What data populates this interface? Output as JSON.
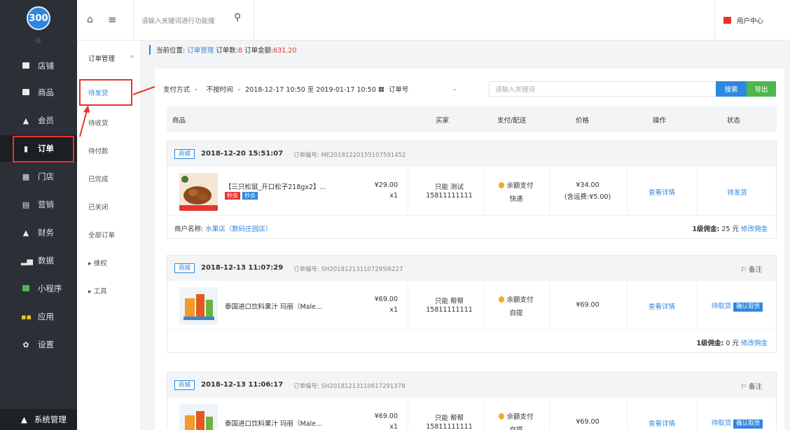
{
  "app": {
    "logo_text": "300"
  },
  "sidebar": {
    "items": [
      {
        "label": "店铺",
        "icon": "store-icon"
      },
      {
        "label": "商品",
        "icon": "product-icon"
      },
      {
        "label": "会员",
        "icon": "member-icon"
      },
      {
        "label": "订单",
        "icon": "order-icon",
        "active": true
      },
      {
        "label": "门店",
        "icon": "shop-icon"
      },
      {
        "label": "营销",
        "icon": "marketing-icon"
      },
      {
        "label": "财务",
        "icon": "finance-icon"
      },
      {
        "label": "数据",
        "icon": "data-icon"
      },
      {
        "label": "小程序",
        "icon": "miniprogram-icon"
      },
      {
        "label": "应用",
        "icon": "apps-icon"
      },
      {
        "label": "设置",
        "icon": "settings-icon"
      }
    ],
    "bottom_label": "系统管理"
  },
  "topbar": {
    "search_placeholder": "请输入关键词进行功能搜",
    "user_center": "用户中心"
  },
  "subnav": {
    "title": "订单管理",
    "items": [
      "待发货",
      "待收货",
      "待付款",
      "已完成",
      "已关闭",
      "全部订单",
      "维权",
      "工具"
    ]
  },
  "breadcrumb": {
    "prefix": "当前位置:",
    "current": "订单管理",
    "count_label": "订单数:",
    "count": "8",
    "amount_label": "订单金额:",
    "amount": "631.20"
  },
  "filters": {
    "payment": "支付方式",
    "time_mode": "不按时间",
    "date_range": "2018-12-17 10:50 至 2019-01-17 10:50",
    "field": "订单号",
    "keyword_placeholder": "请输入关键词",
    "search_label": "搜索",
    "export_label": "导出"
  },
  "table": {
    "headers": [
      "商品",
      "买家",
      "支付/配送",
      "价格",
      "操作",
      "状态"
    ]
  },
  "orders": [
    {
      "tag": "商城",
      "time": "2018-12-20 15:51:07",
      "order_no": "订单编号: ME20181220155107591452",
      "product": "【三只松鼠_开口松子218gx2】...",
      "badges": [
        "秒杀",
        "秒杀"
      ],
      "unit_price": "¥29.00",
      "qty": "x1",
      "buyer_name": "只能 测试",
      "buyer_phone": "15811111111",
      "pay_method": "余额支付",
      "delivery": "快递",
      "total": "¥34.00",
      "shipping": "(含运费:¥5.00)",
      "action": "查看详情",
      "status": "待发货",
      "merchant_label": "商户名称:",
      "merchant": "水果店（数码庄园店）",
      "commission_label": "1级佣金:",
      "commission": "25 元",
      "commission_edit": "修改佣金"
    },
    {
      "tag": "商城",
      "time": "2018-12-13 11:07:29",
      "order_no": "订单编号: SH201812131107295l6227",
      "remark": "备注",
      "product": "泰国进口饮料果汁 玛丽（Male...",
      "unit_price": "¥69.00",
      "qty": "x1",
      "buyer_name": "只能 帮帮",
      "buyer_phone": "15811111111",
      "pay_method": "余额支付",
      "delivery": "自提",
      "total": "¥69.00",
      "action": "查看详情",
      "status": "待取货",
      "confirm": "确认取货",
      "commission_label": "1级佣金:",
      "commission": "0 元",
      "commission_edit": "修改佣金"
    },
    {
      "tag": "商城",
      "time": "2018-12-13 11:06:17",
      "order_no": "订单编号: SH20181213110617291378",
      "remark": "备注",
      "product": "泰国进口饮料果汁 玛丽（Male...",
      "unit_price": "¥69.00",
      "qty": "x1",
      "buyer_name": "只能 帮帮",
      "buyer_phone": "15811111111",
      "pay_method": "余额支付",
      "delivery": "自提",
      "total": "¥69.00",
      "action": "查看详情",
      "status": "待取货",
      "confirm": "确认取货"
    }
  ],
  "colors": {
    "primary": "#2e87de",
    "sidebar": "#2b2f36",
    "highlight": "#e8342c",
    "export": "#4cb84c"
  }
}
